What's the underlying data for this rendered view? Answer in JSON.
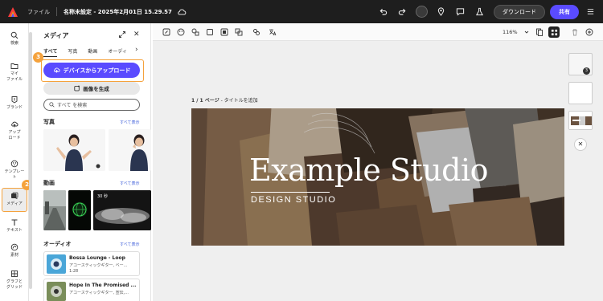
{
  "topbar": {
    "file_menu": "ファイル",
    "doc_title": "名称未設定 - 2025年2月01日 15.29.57",
    "download_label": "ダウンロード",
    "share_label": "共有"
  },
  "rail": {
    "items": [
      {
        "label": "検索"
      },
      {
        "label": "マイ\nファイル"
      },
      {
        "label": "ブランド"
      },
      {
        "label": "アップ\nロード"
      },
      {
        "label": "テンプレー\nト"
      },
      {
        "label": "メディア"
      },
      {
        "label": "テキスト"
      },
      {
        "label": "素材"
      },
      {
        "label": "グラフと\nグリッド"
      }
    ]
  },
  "steps": {
    "upload": "3",
    "media": "2"
  },
  "panel": {
    "title": "メディア",
    "tabs": [
      "すべて",
      "写真",
      "動画",
      "オーディ"
    ],
    "upload_label": "デバイスからアップロード",
    "generate_label": "画像を生成",
    "search_placeholder": "すべて を検索",
    "photos_title": "写真",
    "videos_title": "動画",
    "audio_title": "オーディオ",
    "see_all": "すべて表示",
    "video_duration": "30 秒",
    "audio": [
      {
        "title": "Bossa Lounge - Loop",
        "sub": "アコースティックギター, ベー...",
        "dur": "1:28"
      },
      {
        "title": "Hope In The Promised ...",
        "sub": "アコースティックギター, 宣伝,...",
        "dur": ""
      }
    ]
  },
  "canvas": {
    "zoom": "116%",
    "page_label_bold": "1 / 1 ページ",
    "page_label_rest": " - タイトルを追加",
    "slide_title": "Example Studio",
    "slide_subtitle": "DESIGN STUDIO",
    "page_count": "3"
  },
  "colors": {
    "accent": "#5a4bff",
    "highlight": "#f5a23c",
    "topbar": "#1e1e1e"
  }
}
